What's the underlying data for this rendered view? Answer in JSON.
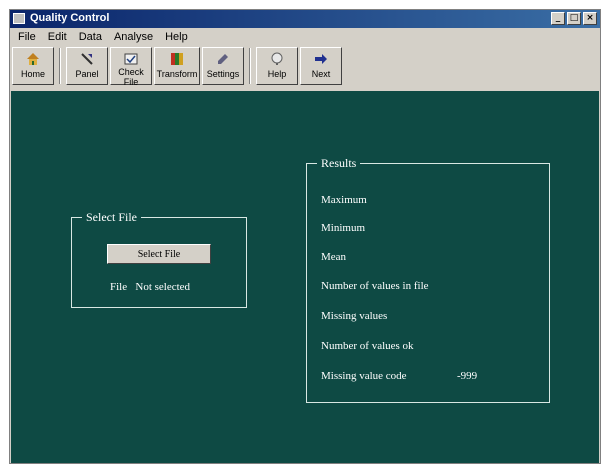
{
  "window": {
    "title": "Quality Control",
    "controls": {
      "minimize": "_",
      "maximize": "□",
      "close": "×"
    }
  },
  "menu": [
    "File",
    "Edit",
    "Data",
    "Analyse",
    "Help"
  ],
  "toolbar": [
    {
      "label": "Home",
      "icon": "home-icon"
    },
    {
      "label": "Panel",
      "icon": "panel-icon"
    },
    {
      "label": "Check File",
      "icon": "check-file-icon"
    },
    {
      "label": "Transform",
      "icon": "transform-icon"
    },
    {
      "label": "Settings",
      "icon": "settings-icon"
    },
    {
      "label": "Help",
      "icon": "help-icon"
    },
    {
      "label": "Next",
      "icon": "next-icon"
    }
  ],
  "select_file": {
    "group_title": "Select File",
    "button_label": "Select File",
    "file_label": "File",
    "file_status": "Not selected"
  },
  "results": {
    "group_title": "Results",
    "rows": [
      {
        "label": "Maximum"
      },
      {
        "label": "Minimum"
      },
      {
        "label": "Mean"
      },
      {
        "label": "Number of values in file"
      },
      {
        "label": "Missing values"
      },
      {
        "label": "Number of values ok"
      },
      {
        "label": "Missing value code",
        "value": "-999"
      }
    ]
  },
  "colors": {
    "client_background": "#0e4a44",
    "titlebar": "#0a246a",
    "face": "#d4d0c8"
  }
}
